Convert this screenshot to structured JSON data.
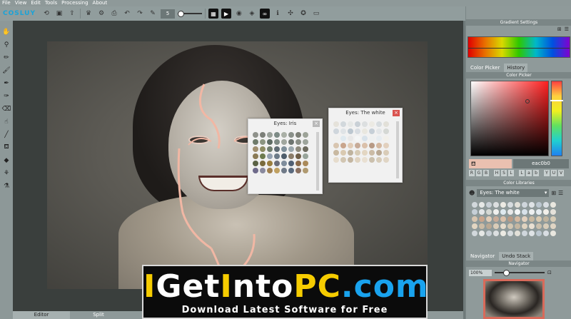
{
  "menu": [
    "File",
    "View",
    "Edit",
    "Tools",
    "Processing",
    "About"
  ],
  "toolbar": {
    "logo": "COSLUY",
    "brush_size": "5"
  },
  "palettes": {
    "iris": {
      "title": "Eyes: Iris",
      "close": "×",
      "columns": 8,
      "swatches": [
        "#8e918a",
        "#7c7f78",
        "#9aa19a",
        "#7d8b86",
        "#aab0a6",
        "#8a9089",
        "#7d7f76",
        "#9da398",
        "#6f7b6a",
        "#8b9480",
        "#5d6b63",
        "#7e8a84",
        "#a0a69e",
        "#6d746f",
        "#8a8f86",
        "#9ea59c",
        "#a08f6e",
        "#8c8b62",
        "#6f7d6d",
        "#5e6b73",
        "#7e8f9a",
        "#9aa7ad",
        "#8d8a7c",
        "#6d6b5e",
        "#8a7a55",
        "#6c7a4e",
        "#94a1b0",
        "#6d7b88",
        "#4f5d6b",
        "#8b7d6a",
        "#6e5e48",
        "#98a49a",
        "#5a6244",
        "#7a6b3c",
        "#9a7e3f",
        "#6b6e7a",
        "#7f8d9c",
        "#506074",
        "#8a6a4a",
        "#aa8a5a",
        "#6e6a8a",
        "#8a8a9e",
        "#a08050",
        "#c0a060",
        "#707a88",
        "#5a6a7e",
        "#8a7060",
        "#b09a70"
      ]
    },
    "white": {
      "title": "Eyes: The white",
      "close": "×",
      "columns": 8,
      "swatches": [
        "#e5e2da",
        "#d2d8dc",
        "#e6e8e6",
        "#c9d0d6",
        "#dcdfe0",
        "#eceae3",
        "#d7dcdf",
        "#e2e0d8",
        "#cfd6dc",
        "#dfe3e6",
        "#bcc7d0",
        "#d8dde2",
        "#e9e7df",
        "#c6cfd7",
        "#e3e6e8",
        "#d5d8d4",
        "#f0f0ee",
        "#dfe9ef",
        "#e8e8e8",
        "#f4f6f6",
        "#d8e2ea",
        "#eef0f0",
        "#e6ecf0",
        "#f2f0ea",
        "#d8c5b0",
        "#c9a58c",
        "#e0cbb6",
        "#c7ab98",
        "#dac0aa",
        "#b89a85",
        "#d4b8a0",
        "#e2d0be",
        "#c8b8a0",
        "#d9c9b0",
        "#bfb39e",
        "#d6cbb5",
        "#e3d6c2",
        "#cbbba5",
        "#b9a893",
        "#d9ccb8",
        "#e6dccc",
        "#d2c6b2",
        "#c4b6a1",
        "#dfd3c0",
        "#e9e0d2",
        "#cbc0ad",
        "#d7ccb9",
        "#e0d5c4"
      ]
    }
  },
  "bottom_tabs": [
    "Editor",
    "Split"
  ],
  "right_panel": {
    "gradient_title": "Gradient Settings",
    "color_tabs": [
      "Color Picker",
      "History"
    ],
    "color_picker_title": "Color Picker",
    "current_color": "#eac0b0",
    "hex_value": "eac0b0",
    "modes": [
      "R",
      "G",
      "B",
      "",
      "H",
      "S",
      "L",
      "",
      "L",
      "a",
      "b",
      "",
      "Y",
      "U",
      "V"
    ],
    "color_libraries_title": "Color Libraries",
    "library_selected": "Eyes: The white",
    "library_swatches": [
      "#d2d8dc",
      "#e6e8e6",
      "#c9d0d6",
      "#dcdfe0",
      "#eceae3",
      "#d7dcdf",
      "#e2e0d8",
      "#cfd6dc",
      "#dfe3e6",
      "#bcc7d0",
      "#d8dde2",
      "#e9e7df",
      "#c6cfd7",
      "#e3e6e8",
      "#d5d8d4",
      "#f0f0ee",
      "#dfe9ef",
      "#e8e8e8",
      "#f4f6f6",
      "#d8e2ea",
      "#eef0f0",
      "#e6ecf0",
      "#f2f0ea",
      "#e5e2da",
      "#d8c5b0",
      "#c9a58c",
      "#e0cbb6",
      "#c7ab98",
      "#dac0aa",
      "#b89a85",
      "#d4b8a0",
      "#e2d0be",
      "#c8b8a0",
      "#d9c9b0",
      "#bfb39e",
      "#d6cbb5",
      "#e3d6c2",
      "#cbbba5",
      "#b9a893",
      "#d9ccb8",
      "#e6dccc",
      "#d2c6b2",
      "#c4b6a1",
      "#dfd3c0",
      "#e9e0d2",
      "#cbc0ad",
      "#d7ccb9",
      "#e0d5c4",
      "#d2d8dc",
      "#e6e8e6",
      "#c9d0d6",
      "#dcdfe0",
      "#eceae3",
      "#d7dcdf",
      "#e2e0d8",
      "#cfd6dc",
      "#dfe3e6",
      "#bcc7d0",
      "#d8dde2",
      "#e9e7df"
    ],
    "nav_tabs": [
      "Navigator",
      "Undo Stack"
    ],
    "navigator_title": "Navigator",
    "zoom": "100%"
  },
  "watermark": {
    "logo_parts": [
      {
        "text": "I",
        "color": "y"
      },
      {
        "text": "Get",
        "color": "w"
      },
      {
        "text": "I",
        "color": "y"
      },
      {
        "text": "nto",
        "color": "w"
      },
      {
        "text": "PC",
        "color": "y"
      },
      {
        "text": ".com",
        "color": "b"
      }
    ],
    "tagline": "Download Latest Software for Free"
  },
  "colors": {
    "accent_peach": "#eac0b0",
    "close_red": "#d9534f",
    "watermark_yellow": "#f6cc00",
    "watermark_blue": "#19a3ee"
  }
}
